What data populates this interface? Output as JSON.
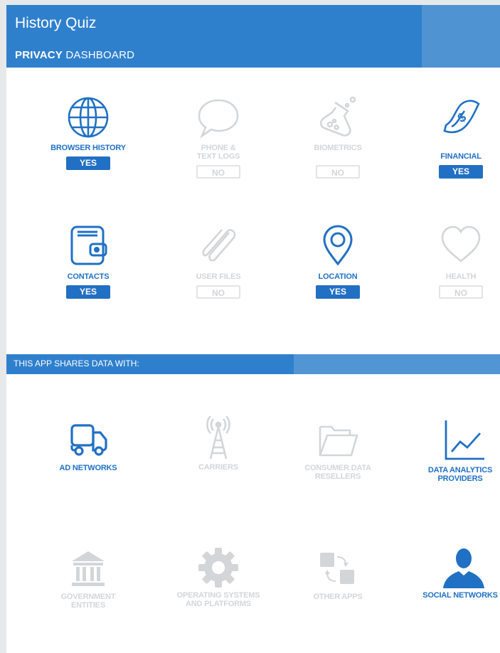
{
  "header": {
    "app_title": "History Quiz",
    "dash_bold": "PRIVACY",
    "dash_rest": " DASHBOARD"
  },
  "colors": {
    "accent": "#2f80cc",
    "active": "#2070c4",
    "inactive": "#d3d6d9"
  },
  "categories": [
    {
      "icon": "globe-icon",
      "label": "BROWSER HISTORY",
      "state": "YES",
      "active": true
    },
    {
      "icon": "speech-bubble-icon",
      "label": "PHONE & TEXT LOGS",
      "state": "NO",
      "active": false
    },
    {
      "icon": "flask-icon",
      "label": "BIOMETRICS",
      "state": "NO",
      "active": false
    },
    {
      "icon": "money-bill-icon",
      "label": "FINANCIAL",
      "state": "YES",
      "active": true
    },
    {
      "icon": "wallet-icon",
      "label": "CONTACTS",
      "state": "YES",
      "active": true
    },
    {
      "icon": "paperclip-icon",
      "label": "USER FILES",
      "state": "NO",
      "active": false
    },
    {
      "icon": "map-pin-icon",
      "label": "LOCATION",
      "state": "YES",
      "active": true
    },
    {
      "icon": "heart-icon",
      "label": "HEALTH",
      "state": "NO",
      "active": false
    }
  ],
  "sharing": {
    "title": "THIS APP SHARES DATA WITH:",
    "items": [
      {
        "icon": "truck-icon",
        "label": "AD NETWORKS",
        "active": true
      },
      {
        "icon": "antenna-icon",
        "label": "CARRIERS",
        "active": false
      },
      {
        "icon": "folder-icon",
        "label": "CONSUMER DATA RESELLERS",
        "active": false
      },
      {
        "icon": "line-chart-icon",
        "label": "DATA ANALYTICS PROVIDERS",
        "active": true
      },
      {
        "icon": "government-building-icon",
        "label": "GOVERNMENT ENTITIES",
        "active": false
      },
      {
        "icon": "gear-icon",
        "label": "OPERATING SYSTEMS AND PLATFORMS",
        "active": false
      },
      {
        "icon": "app-exchange-icon",
        "label": "OTHER APPS",
        "active": false
      },
      {
        "icon": "person-icon",
        "label": "SOCIAL NETWORKS",
        "active": true
      }
    ]
  }
}
